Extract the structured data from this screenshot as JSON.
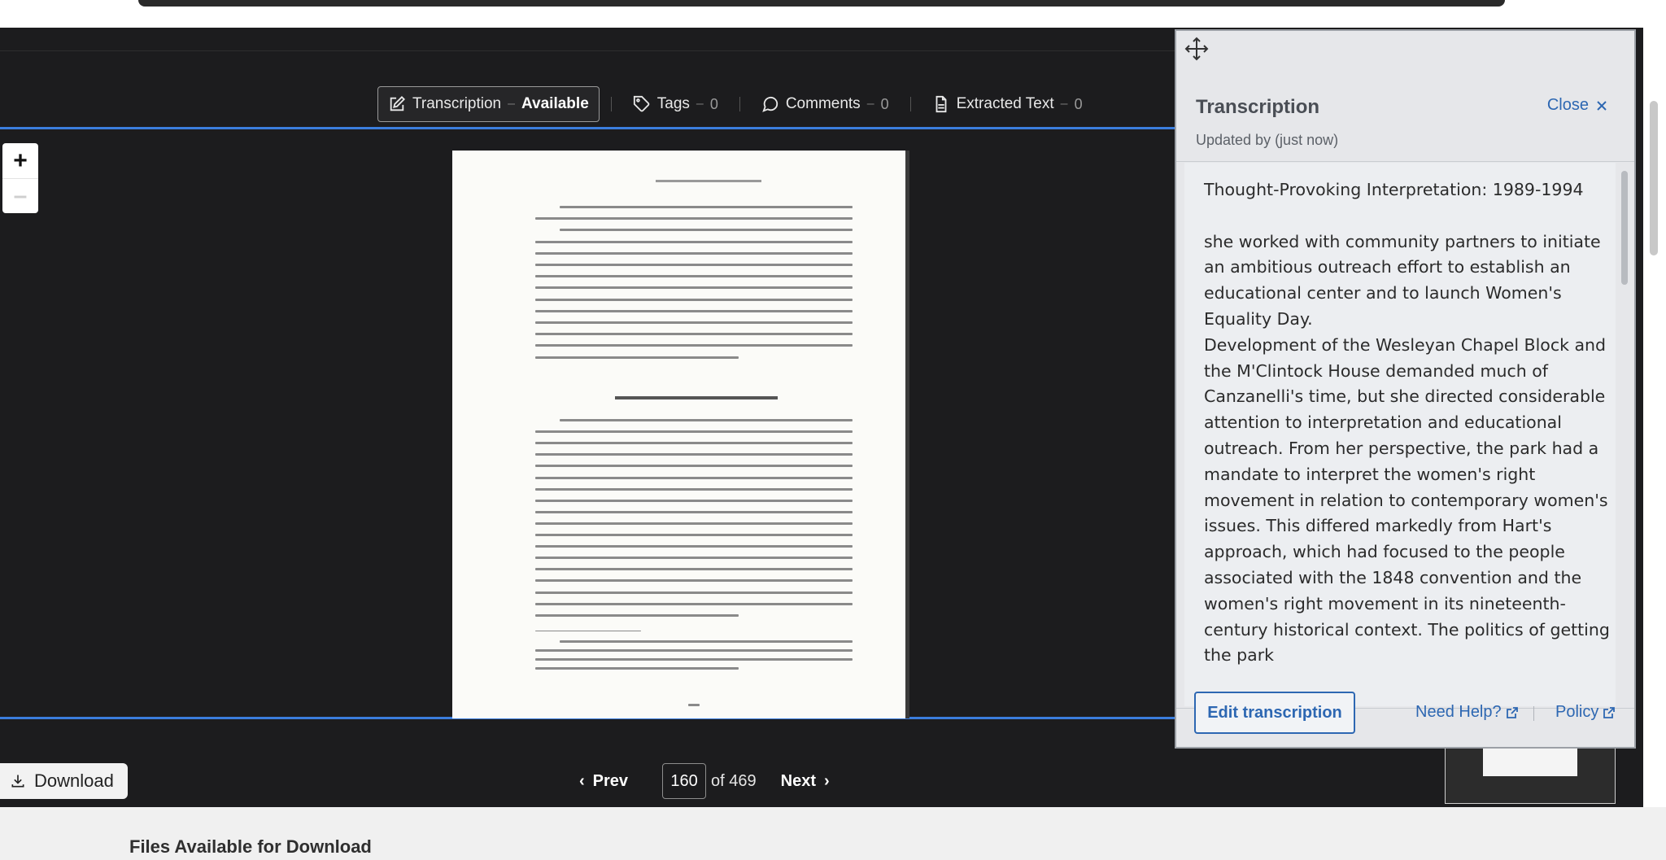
{
  "toolbar": {
    "tabs": [
      {
        "label": "Transcription",
        "status": "Available",
        "icon": "edit-icon"
      },
      {
        "label": "Tags",
        "count": "0",
        "icon": "tag-icon"
      },
      {
        "label": "Comments",
        "count": "0",
        "icon": "comment-icon"
      },
      {
        "label": "Extracted Text",
        "count": "0",
        "icon": "document-icon"
      }
    ],
    "separator": "–"
  },
  "zoom": {
    "in_label": "+",
    "out_label": "–"
  },
  "download": {
    "label": "Download",
    "icon": "download-icon"
  },
  "pager": {
    "prev_label": "Prev",
    "next_label": "Next",
    "current_page": "160",
    "total_label": "of 469"
  },
  "lower": {
    "heading": "Files Available for Download"
  },
  "panel": {
    "title": "Transcription",
    "close_label": "Close",
    "updated": "Updated by (just now)",
    "text_title": "Thought-Provoking Interpretation: 1989-1994",
    "paragraph_1": "she worked with community partners to initiate an ambitious outreach effort to establish an educational center and to launch Women's Equality Day.",
    "paragraph_2": "Development of the Wesleyan Chapel Block and the M'Clintock House demanded much of Canzanelli's time, but she directed considerable attention to interpretation and educational outreach. From her perspective, the park had a mandate to interpret the women's right movement in relation to contemporary women's issues. This differed markedly from Hart's approach, which had focused to the people associated with the 1848 convention and the women's right movement in its nineteenth-century historical context. The politics of getting the park",
    "edit_label": "Edit transcription",
    "help_label": "Need Help?",
    "policy_label": "Policy"
  },
  "colors": {
    "viewer_bg": "#1c1c1e",
    "accent_blue": "#2d67b2",
    "frame_blue": "#3b7ddd",
    "panel_bg": "#e6e7ea"
  }
}
